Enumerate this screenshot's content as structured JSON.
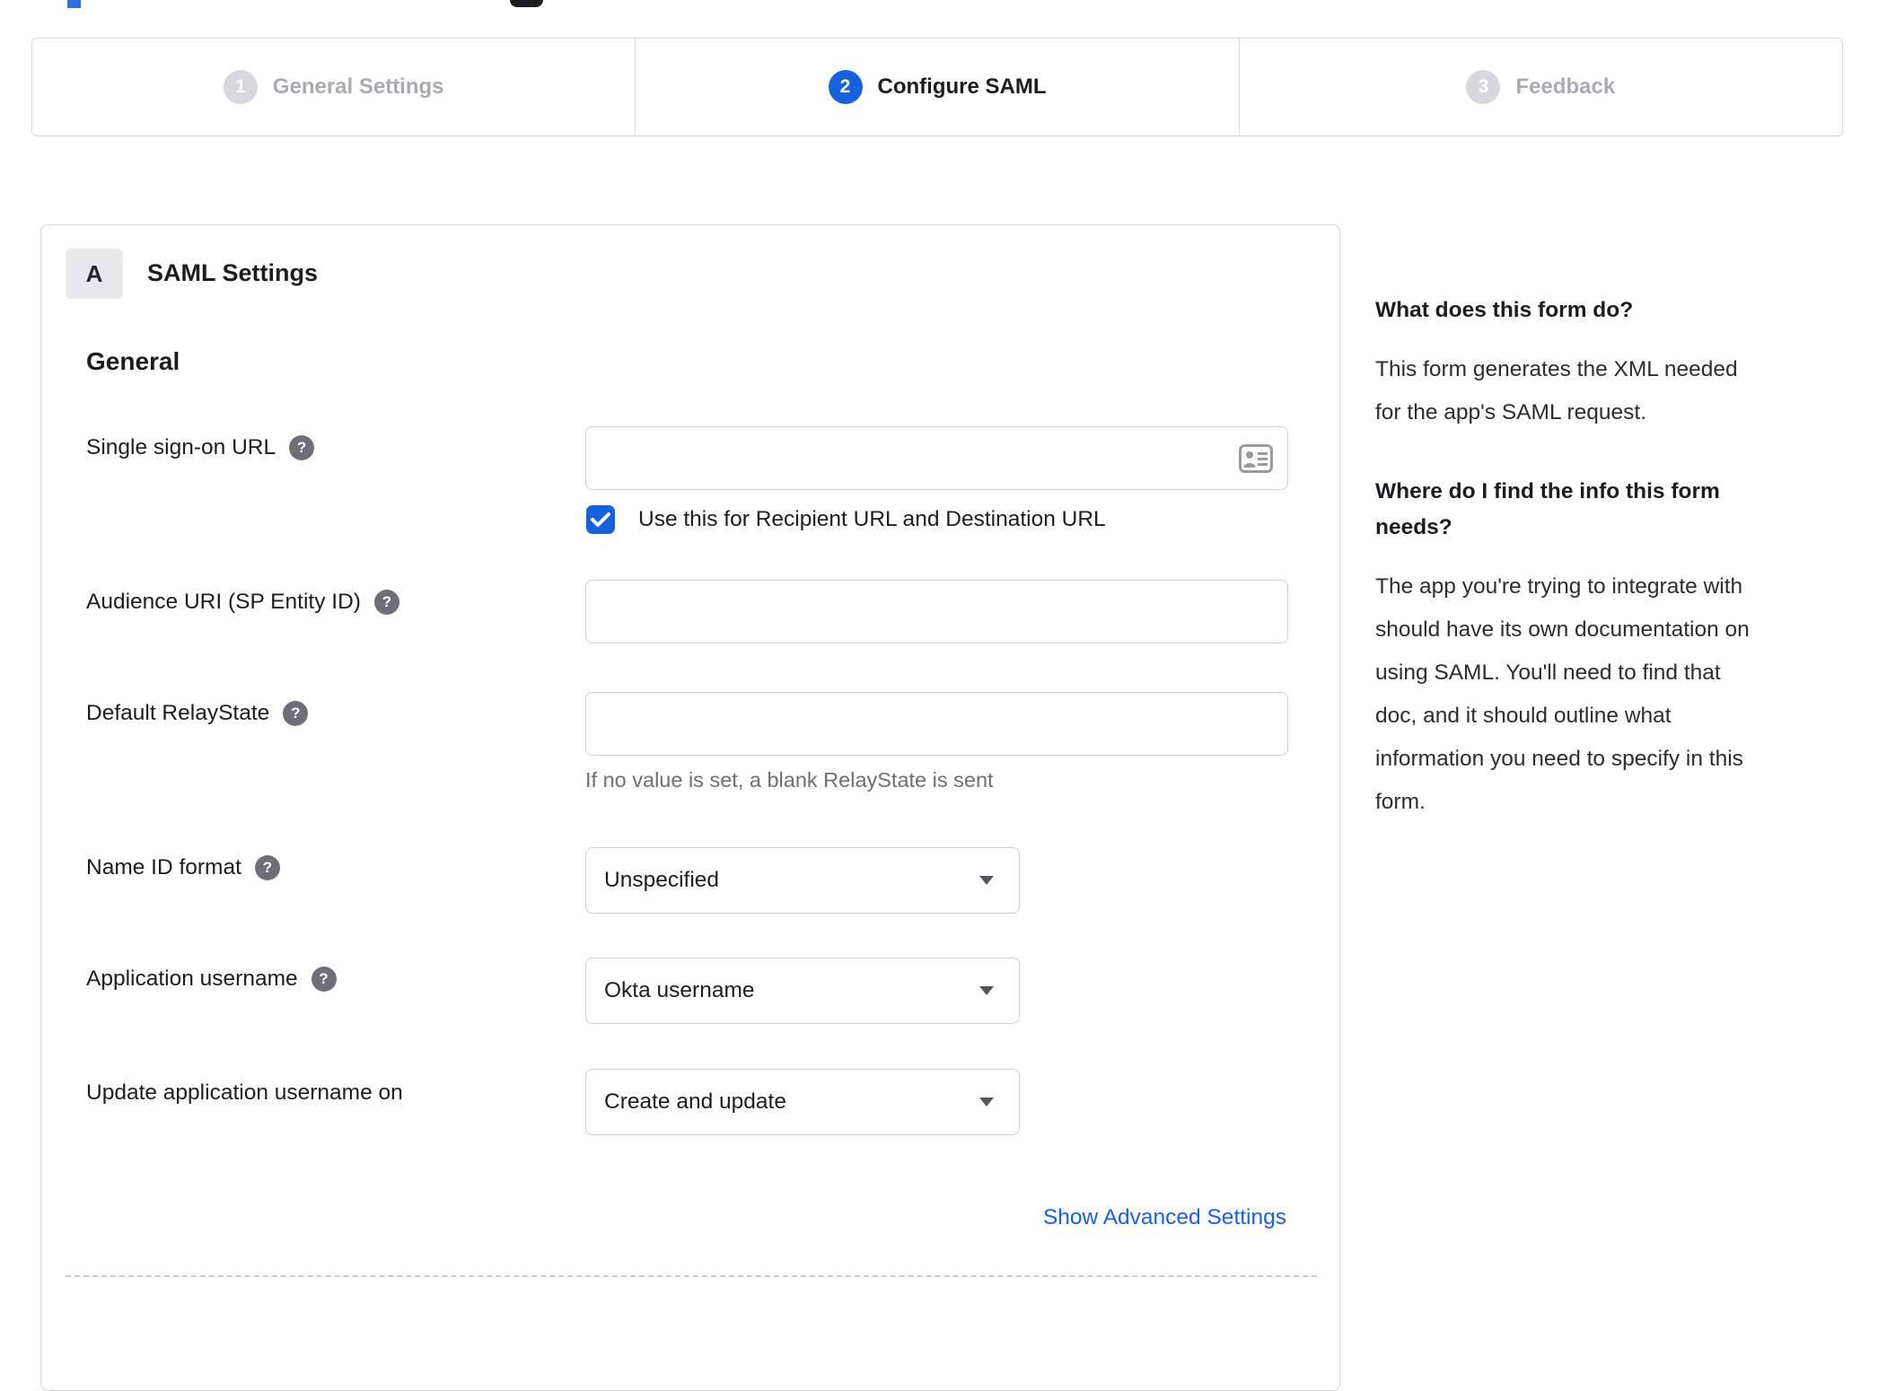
{
  "stepper": {
    "steps": [
      {
        "number": "1",
        "label": "General Settings",
        "state": "inactive"
      },
      {
        "number": "2",
        "label": "Configure SAML",
        "state": "active"
      },
      {
        "number": "3",
        "label": "Feedback",
        "state": "inactive"
      }
    ]
  },
  "panel": {
    "section_badge": "A",
    "section_title": "SAML Settings",
    "group_title": "General",
    "fields": {
      "sso_url": {
        "label": "Single sign-on URL",
        "value": "",
        "has_help": true
      },
      "sso_checkbox": {
        "label": "Use this for Recipient URL and Destination URL",
        "checked": true
      },
      "audience_uri": {
        "label": "Audience URI (SP Entity ID)",
        "value": "",
        "has_help": true
      },
      "default_relay_state": {
        "label": "Default RelayState",
        "value": "",
        "has_help": true,
        "hint": "If no value is set, a blank RelayState is sent"
      },
      "name_id_format": {
        "label": "Name ID format",
        "selected": "Unspecified",
        "has_help": true
      },
      "application_username": {
        "label": "Application username",
        "selected": "Okta username",
        "has_help": true
      },
      "update_app_username": {
        "label": "Update application username on",
        "selected": "Create and update",
        "has_help": false
      }
    },
    "advanced_link_label": "Show Advanced Settings"
  },
  "help_sidebar": {
    "sections": [
      {
        "heading": "What does this form do?",
        "body": "This form generates the XML needed\nfor the app's SAML request."
      },
      {
        "heading": "Where do I find the info this form\nneeds?",
        "body": "The app you're trying to integrate with\nshould have its own documentation on\nusing SAML. You'll need to find that\ndoc, and it should outline what\ninformation you need to specify in this\nform."
      }
    ]
  },
  "colors": {
    "accent_blue": "#1662dd",
    "text_dark": "#1d1d21",
    "text_muted": "#6e6e78",
    "inactive_gray": "#d8d8dc",
    "border_gray": "#d5d5da"
  },
  "help_icon_glyph": "?"
}
